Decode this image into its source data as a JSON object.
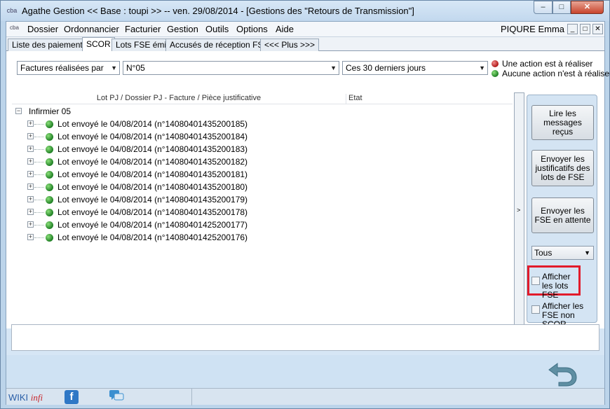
{
  "window": {
    "title": "Agathe Gestion << Base : toupi >>   --   ven. 29/08/2014  - [Gestions des \"Retours de Transmission\"]",
    "app_icon": "cba",
    "controls": {
      "minimize": "–",
      "maximize": "□",
      "close": "✕"
    }
  },
  "menu": {
    "icon": "cba",
    "items": [
      "Dossier",
      "Ordonnancier",
      "Facturier",
      "Gestion",
      "Outils",
      "Options",
      "Aide"
    ],
    "user": "PIQURE Emma",
    "mdi_controls": [
      "_",
      "□",
      "✕"
    ]
  },
  "tabs": [
    {
      "label": "Liste des paiements",
      "active": false
    },
    {
      "label": "SCOR",
      "active": true
    },
    {
      "label": "Lots FSE émis",
      "active": false
    },
    {
      "label": "Accusés de réception FSE",
      "active": false
    },
    {
      "label": "<<< Plus >>>",
      "active": false
    }
  ],
  "filters": {
    "type_value": "Factures réalisées par",
    "practitioner_value": "N°05",
    "period_value": "Ces 30 derniers jours"
  },
  "legend": {
    "action_needed": "Une action est à réaliser",
    "no_action": "Aucune action n'est à réaliser",
    "action_color": "#d22020",
    "ok_color": "#2e9a2e"
  },
  "grid": {
    "columns": [
      "Lot PJ / Dossier PJ - Facture / Pièce justificative",
      "Etat"
    ],
    "root": "Infirmier 05",
    "rows": [
      "Lot envoyé le 04/08/2014 (n°14080401435200185)",
      "Lot envoyé le 04/08/2014 (n°14080401435200184)",
      "Lot envoyé le 04/08/2014 (n°14080401435200183)",
      "Lot envoyé le 04/08/2014 (n°14080401435200182)",
      "Lot envoyé le 04/08/2014 (n°14080401435200181)",
      "Lot envoyé le 04/08/2014 (n°14080401435200180)",
      "Lot envoyé le 04/08/2014 (n°14080401435200179)",
      "Lot envoyé le 04/08/2014 (n°14080401435200178)",
      "Lot envoyé le 04/08/2014 (n°14080401425200177)",
      "Lot envoyé le 04/08/2014 (n°14080401425200176)"
    ]
  },
  "splitter": ">",
  "actions": {
    "read_messages": "Lire les messages reçus",
    "send_justificatifs": "Envoyer les justificatifs des lots de FSE",
    "send_pending": "Envoyer les FSE en attente",
    "filter_value": "Tous",
    "show_fse_lots": "Afficher les lots FSE",
    "show_non_scor": "Afficher les FSE non SCOR"
  },
  "statusbar": {
    "wiki": "WIKI",
    "infi": "infi",
    "facebook": "f"
  }
}
